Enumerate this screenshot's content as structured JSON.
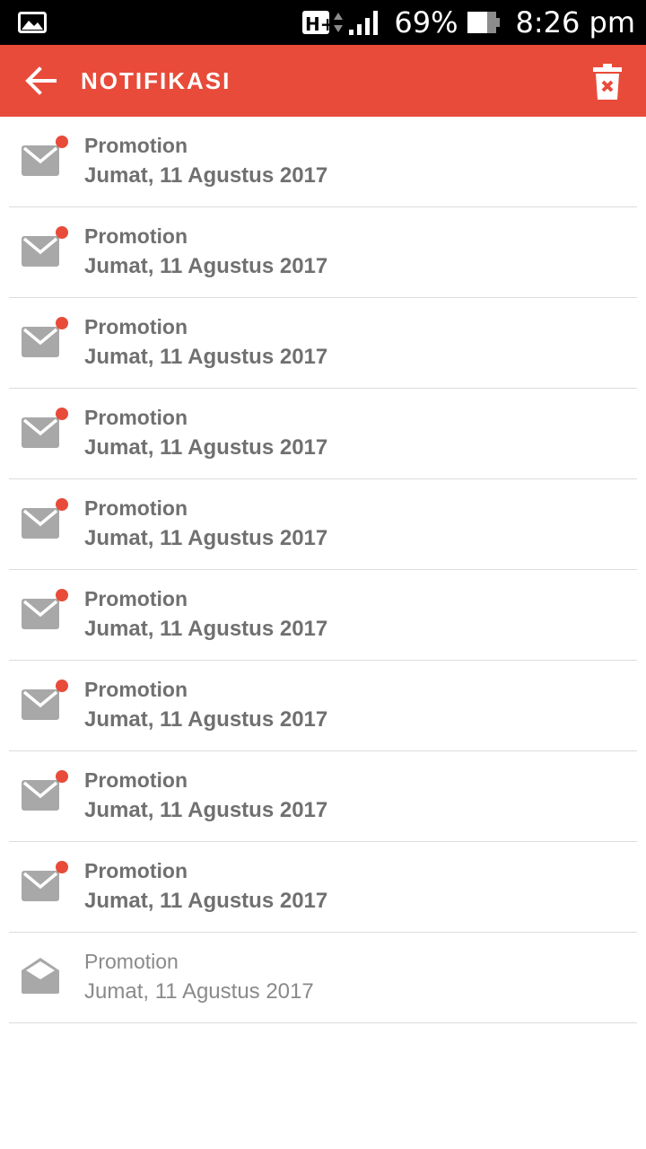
{
  "status_bar": {
    "network_type": "H+",
    "battery_percent": "69%",
    "time": "8:26 pm",
    "icons": [
      "image-icon",
      "network-type-icon",
      "data-arrows-icon",
      "signal-icon",
      "battery-icon"
    ]
  },
  "app_bar": {
    "title": "NOTIFIKASI",
    "background_color": "#e84b3a",
    "icons": [
      "back-arrow-icon",
      "trash-icon"
    ]
  },
  "notifications": [
    {
      "title": "Promotion",
      "date": "Jumat, 11 Agustus 2017",
      "status": "unread",
      "icon": "closed-mail-icon"
    },
    {
      "title": "Promotion",
      "date": "Jumat, 11 Agustus 2017",
      "status": "unread",
      "icon": "closed-mail-icon"
    },
    {
      "title": "Promotion",
      "date": "Jumat, 11 Agustus 2017",
      "status": "unread",
      "icon": "closed-mail-icon"
    },
    {
      "title": "Promotion",
      "date": "Jumat, 11 Agustus 2017",
      "status": "unread",
      "icon": "closed-mail-icon"
    },
    {
      "title": "Promotion",
      "date": "Jumat, 11 Agustus 2017",
      "status": "unread",
      "icon": "closed-mail-icon"
    },
    {
      "title": "Promotion",
      "date": "Jumat, 11 Agustus 2017",
      "status": "unread",
      "icon": "closed-mail-icon"
    },
    {
      "title": "Promotion",
      "date": "Jumat, 11 Agustus 2017",
      "status": "unread",
      "icon": "closed-mail-icon"
    },
    {
      "title": "Promotion",
      "date": "Jumat, 11 Agustus 2017",
      "status": "unread",
      "icon": "closed-mail-icon"
    },
    {
      "title": "Promotion",
      "date": "Jumat, 11 Agustus 2017",
      "status": "unread",
      "icon": "closed-mail-icon"
    },
    {
      "title": "Promotion",
      "date": "Jumat, 11 Agustus 2017",
      "status": "read",
      "icon": "open-mail-icon"
    }
  ],
  "colors": {
    "accent": "#e84b3a",
    "unread_dot": "#e84b3a",
    "icon_gray": "#a8a8a8",
    "text_gray": "#707070"
  }
}
